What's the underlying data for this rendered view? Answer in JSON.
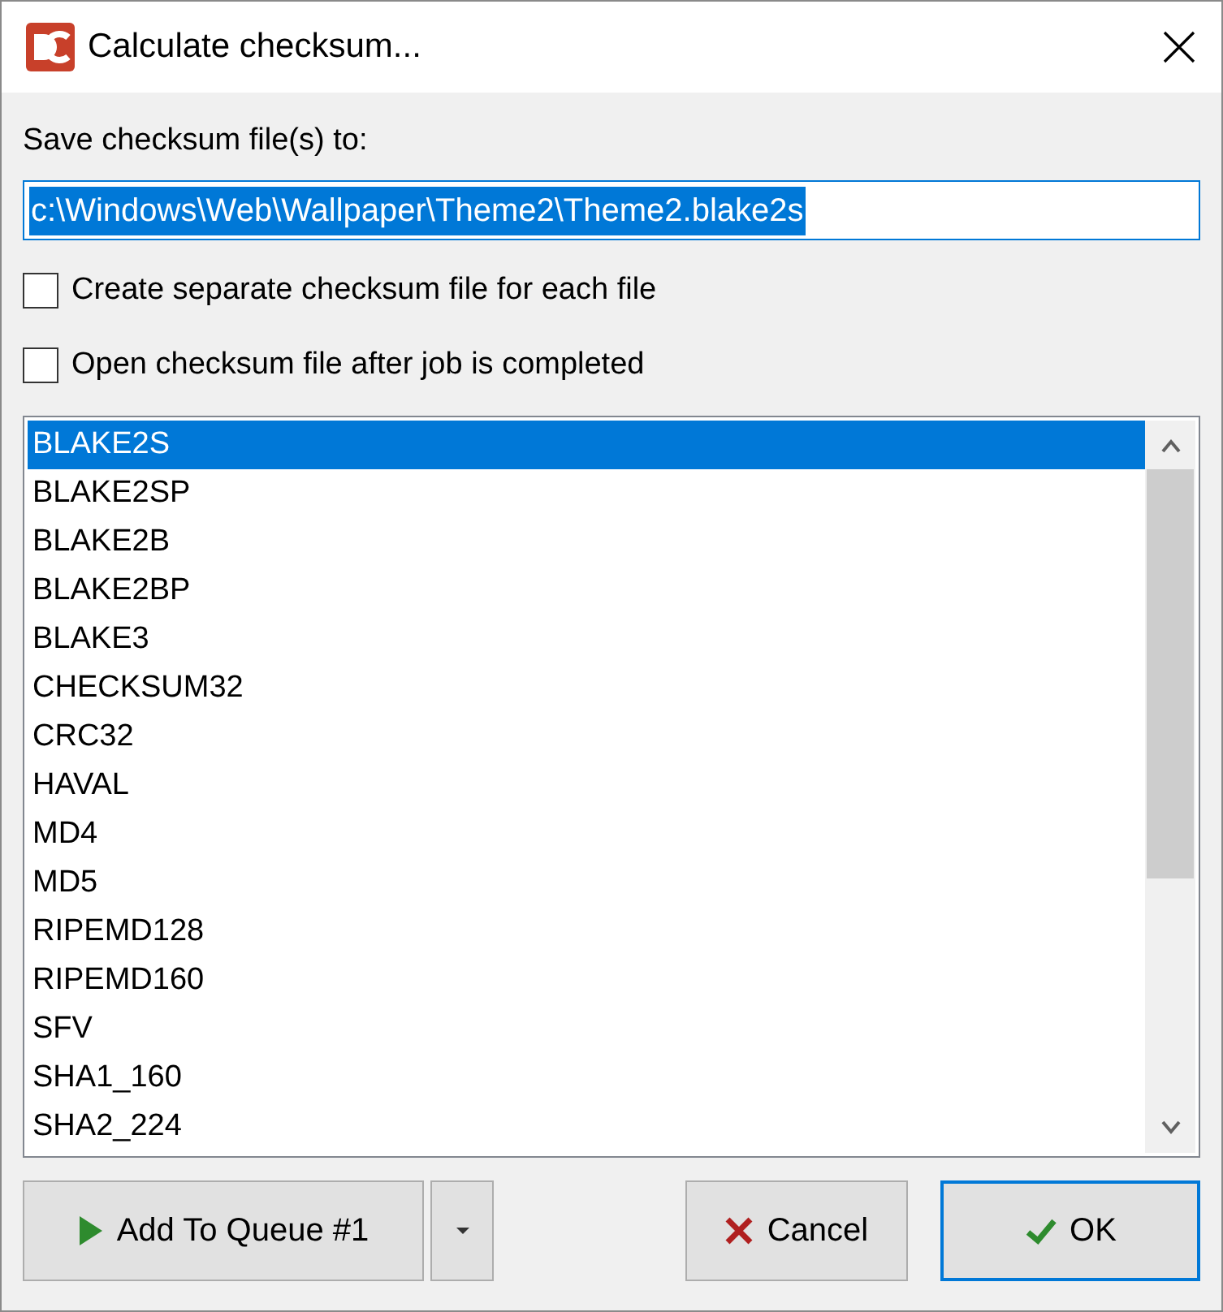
{
  "window": {
    "title": "Calculate checksum..."
  },
  "save_label": "Save checksum file(s) to:",
  "path_field": {
    "value": "c:\\Windows\\Web\\Wallpaper\\Theme2\\Theme2.blake2s",
    "selected": true
  },
  "options": [
    {
      "label": "Create separate checksum file for each file",
      "checked": false
    },
    {
      "label": "Open checksum file after job is completed",
      "checked": false
    }
  ],
  "algorithms": [
    {
      "label": "BLAKE2S",
      "selected": true
    },
    {
      "label": "BLAKE2SP",
      "selected": false
    },
    {
      "label": "BLAKE2B",
      "selected": false
    },
    {
      "label": "BLAKE2BP",
      "selected": false
    },
    {
      "label": "BLAKE3",
      "selected": false
    },
    {
      "label": "CHECKSUM32",
      "selected": false
    },
    {
      "label": "CRC32",
      "selected": false
    },
    {
      "label": "HAVAL",
      "selected": false
    },
    {
      "label": "MD4",
      "selected": false
    },
    {
      "label": "MD5",
      "selected": false
    },
    {
      "label": "RIPEMD128",
      "selected": false
    },
    {
      "label": "RIPEMD160",
      "selected": false
    },
    {
      "label": "SFV",
      "selected": false
    },
    {
      "label": "SHA1_160",
      "selected": false
    },
    {
      "label": "SHA2_224",
      "selected": false
    }
  ],
  "buttons": {
    "queue": "Add To Queue #1",
    "cancel": "Cancel",
    "ok": "OK"
  }
}
